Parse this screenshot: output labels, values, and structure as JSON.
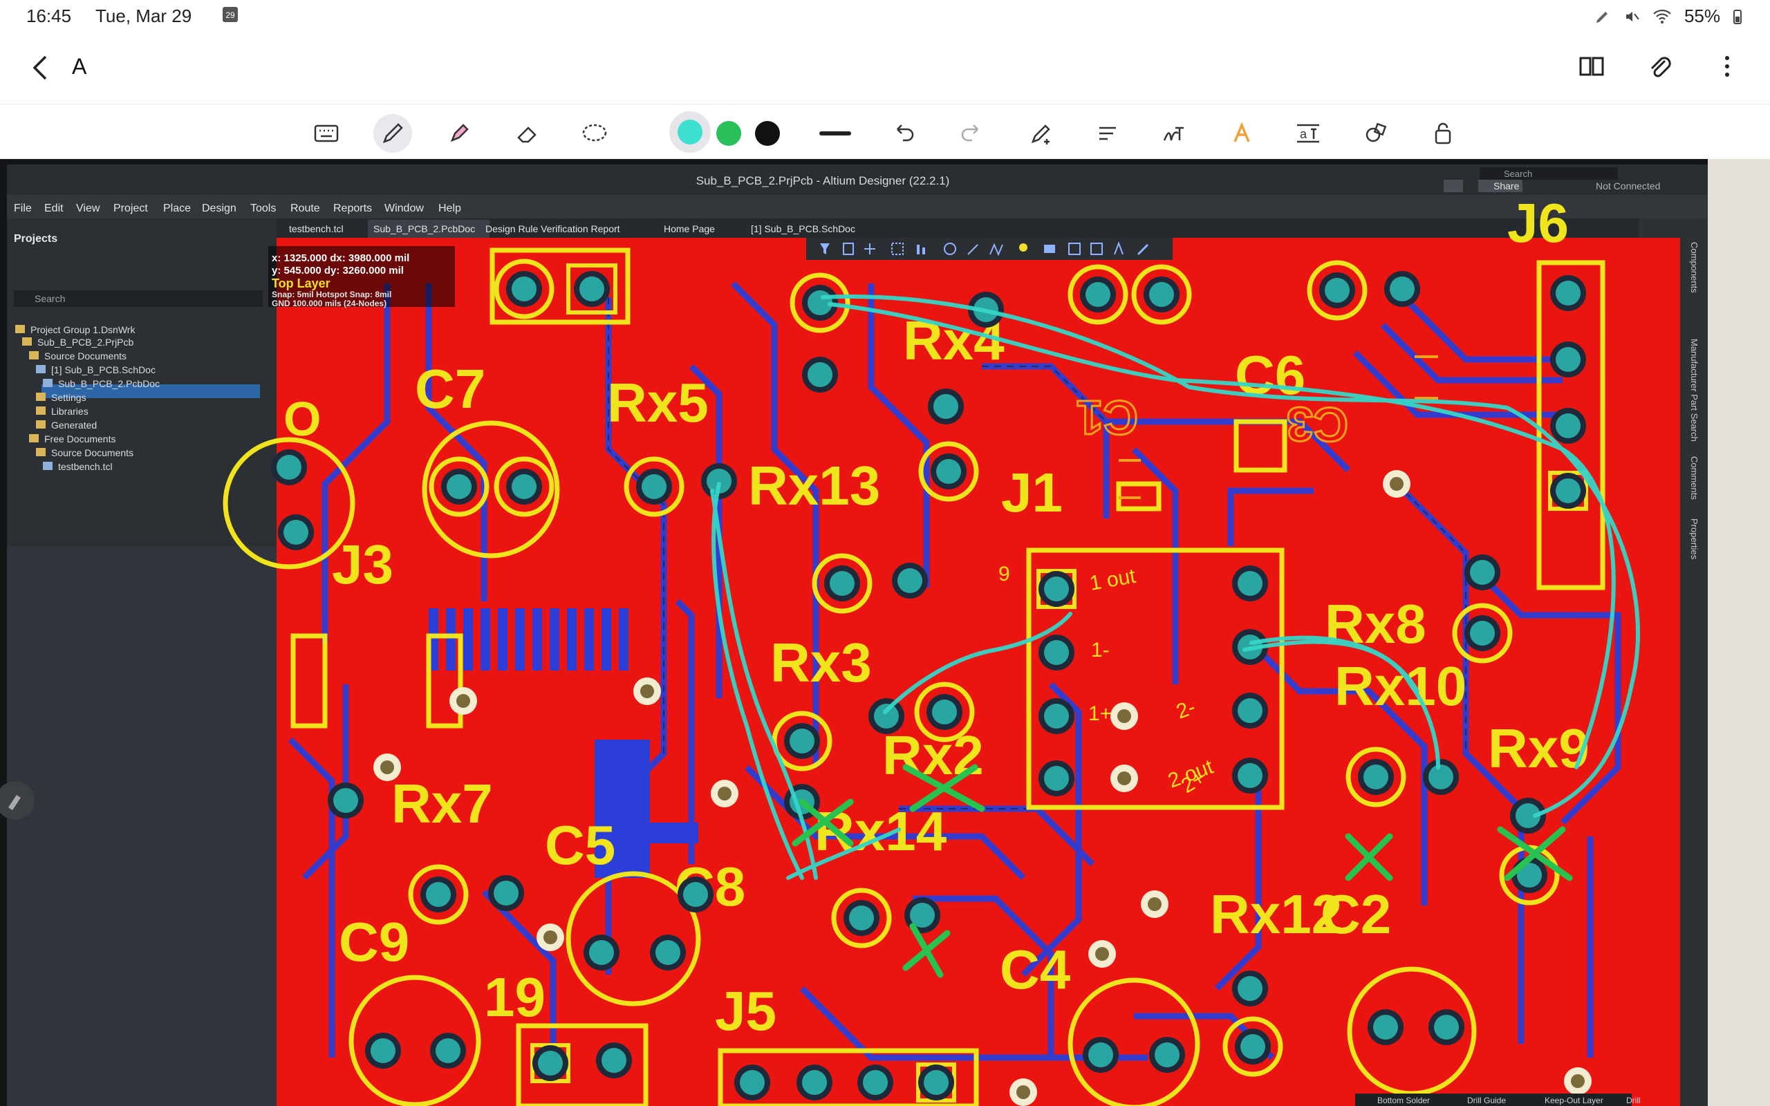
{
  "status": {
    "time": "16:45",
    "date": "Tue, Mar 29",
    "calendar_badge": "29",
    "battery": "55%"
  },
  "appbar": {
    "title": "A"
  },
  "toolbar": {
    "colors": [
      "#3ee0d2",
      "#29c05a",
      "#111111"
    ]
  },
  "altium": {
    "window_title": "Sub_B_PCB_2.PrjPcb - Altium Designer (22.2.1)",
    "search": "Search",
    "share": "Share",
    "not_connected": "Not Connected",
    "menu": [
      "File",
      "Edit",
      "View",
      "Project",
      "Place",
      "Design",
      "Tools",
      "Route",
      "Reports",
      "Window",
      "Help"
    ],
    "tabs": [
      "testbench.tcl",
      "Sub_B_PCB_2.PcbDoc",
      "Design Rule Verification Report",
      "Home Page",
      "[1] Sub_B_PCB.SchDoc"
    ],
    "panel_title": "Projects",
    "panel_search": "Search",
    "tree": [
      "Project Group 1.DsnWrk",
      "Sub_B_PCB_2.PrjPcb",
      "Source Documents",
      "[1] Sub_B_PCB.SchDoc",
      "Sub_B_PCB_2.PcbDoc",
      "Settings",
      "Libraries",
      "Generated",
      "Free Documents",
      "Source Documents",
      "testbench.tcl"
    ],
    "hud": {
      "line1": "x: 1325.000  dx: 3980.000 mil",
      "line2": "y: 545.000  dy: 3260.000 mil",
      "layer": "Top Layer",
      "snap": "Snap: 5mil Hotspot Snap: 8mil",
      "grid": "GND 100.000 mils (24-Nodes)"
    },
    "right_panels": [
      "Components",
      "Manufacturer Part Search",
      "Comments",
      "Properties"
    ],
    "layers": [
      "Bottom Solder",
      "Drill Guide",
      "Keep-Out Layer",
      "Drill"
    ]
  },
  "pcb": {
    "labels": [
      "Rx4",
      "C6",
      "C7",
      "Rx5",
      "Rx13",
      "J1",
      "J3",
      "Rx3",
      "Rx2",
      "Rx8",
      "Rx10",
      "Rx9",
      "Rx7",
      "C5",
      "C8",
      "Rx14",
      "C9",
      "Rx12",
      "C2",
      "C4",
      "19",
      "J5",
      "J6",
      "O",
      "C1",
      "C3"
    ],
    "annotations": [
      "1 out",
      "1-",
      "1+",
      "2 out",
      "2-",
      "2+",
      "9"
    ]
  }
}
